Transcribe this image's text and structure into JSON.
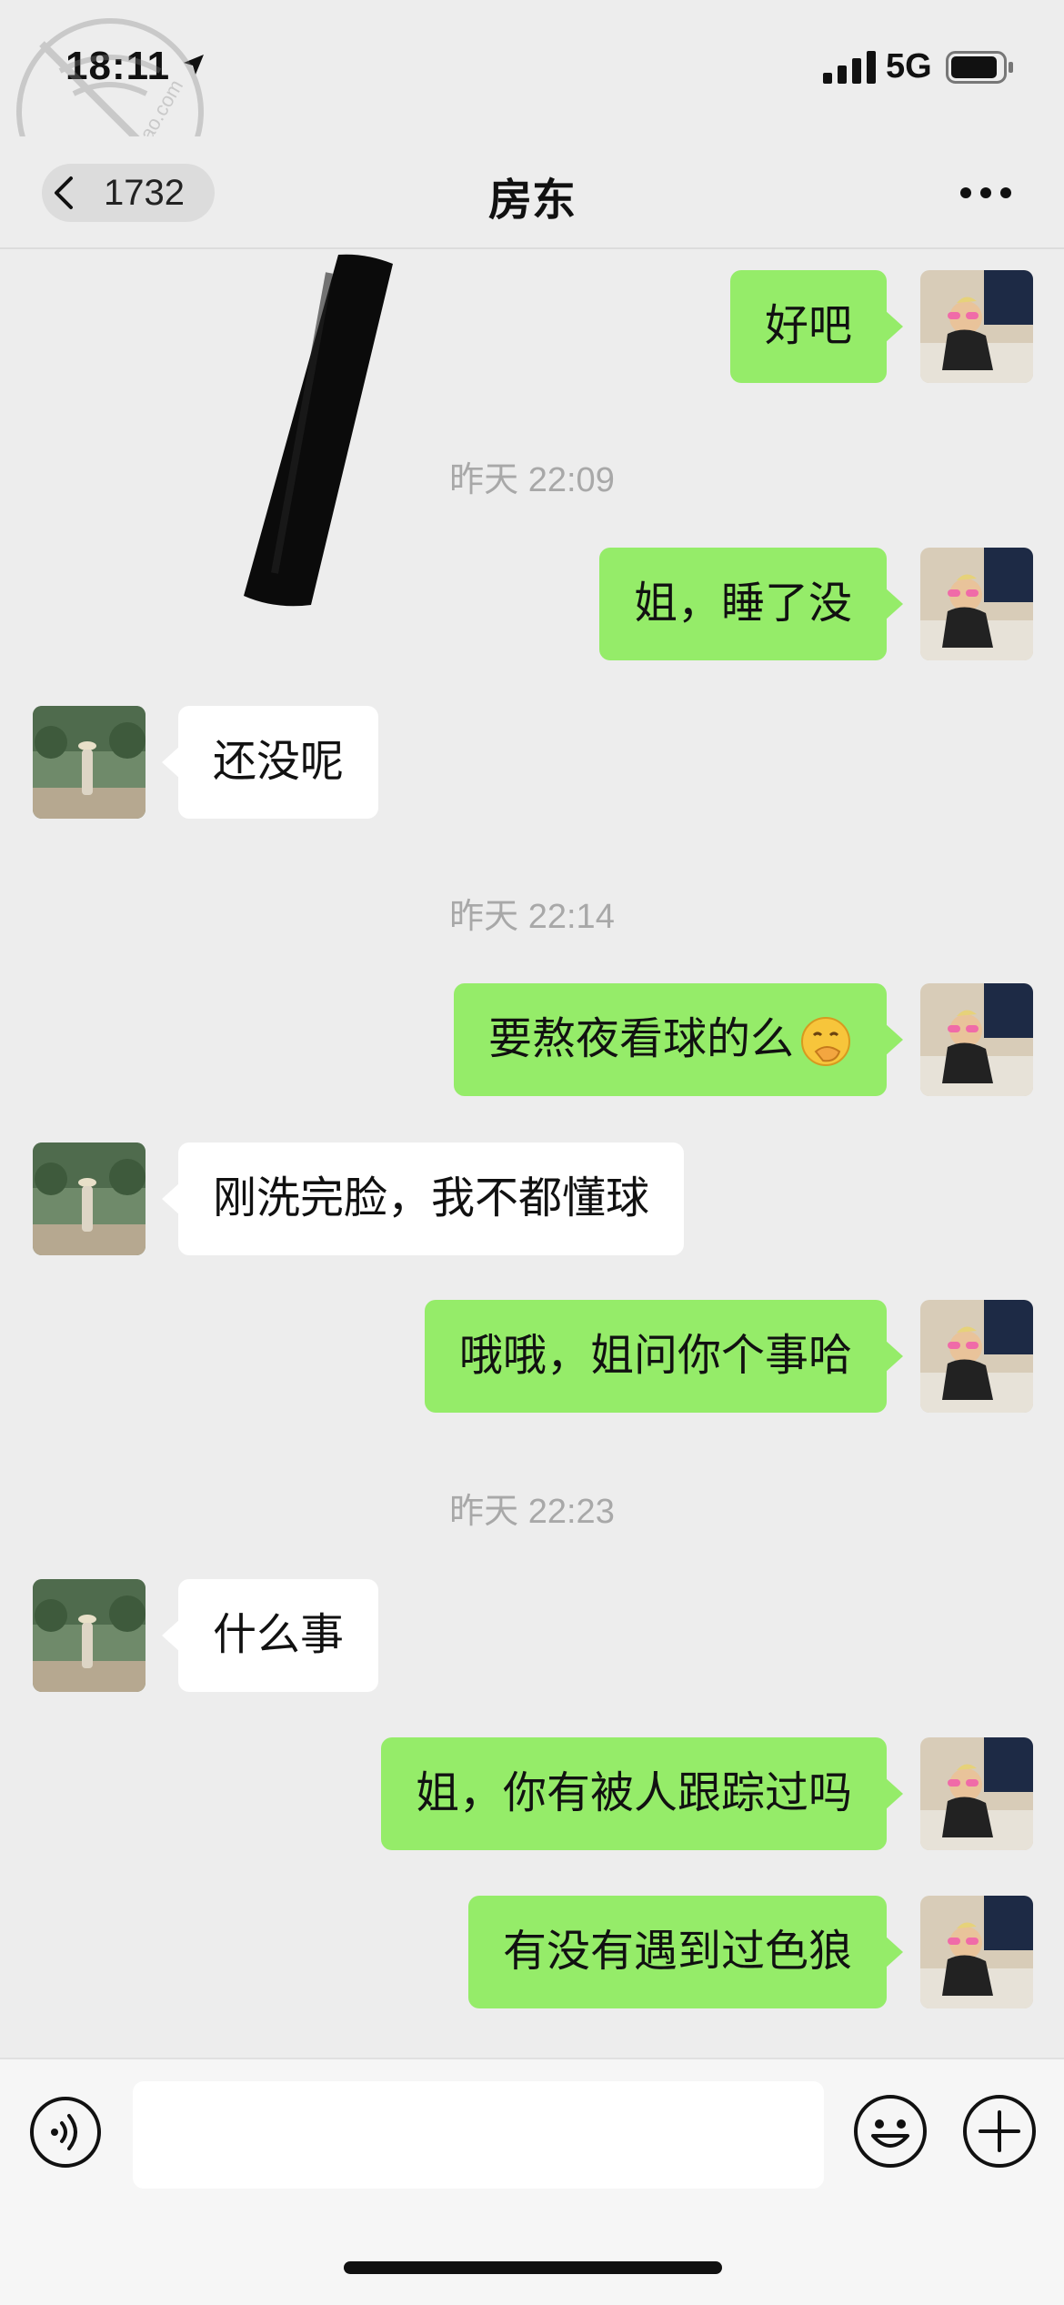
{
  "status_bar": {
    "time": "18:11",
    "network": "5G"
  },
  "nav": {
    "back_count": "1732",
    "title": "房东"
  },
  "messages": [
    {
      "side": "me",
      "text": "好吧"
    },
    {
      "side": "time",
      "text": "昨天 22:09"
    },
    {
      "side": "me",
      "text": "姐，睡了没"
    },
    {
      "side": "them",
      "text": "还没呢"
    },
    {
      "side": "time",
      "text": "昨天 22:14"
    },
    {
      "side": "me",
      "text": "要熬夜看球的么",
      "emoji": "face-with-hand-over-mouth-emoji"
    },
    {
      "side": "them",
      "text": "刚洗完脸，我不都懂球"
    },
    {
      "side": "me",
      "text": "哦哦，姐问你个事哈"
    },
    {
      "side": "time",
      "text": "昨天 22:23"
    },
    {
      "side": "them",
      "text": "什么事"
    },
    {
      "side": "me",
      "text": "姐，你有被人跟踪过吗"
    },
    {
      "side": "me",
      "text": "有没有遇到过色狼"
    }
  ],
  "input": {
    "value": "",
    "placeholder": ""
  },
  "icons": {
    "back": "chevron-left-icon",
    "more": "more-dots-icon",
    "voice": "voice-icon",
    "emoji": "emoji-icon",
    "plus": "plus-icon"
  },
  "colors": {
    "background": "#ededed",
    "my_bubble": "#95ec69",
    "their_bubble": "#ffffff",
    "timestamp": "#a8a8a8"
  },
  "watermark_text": "haijiao.com"
}
